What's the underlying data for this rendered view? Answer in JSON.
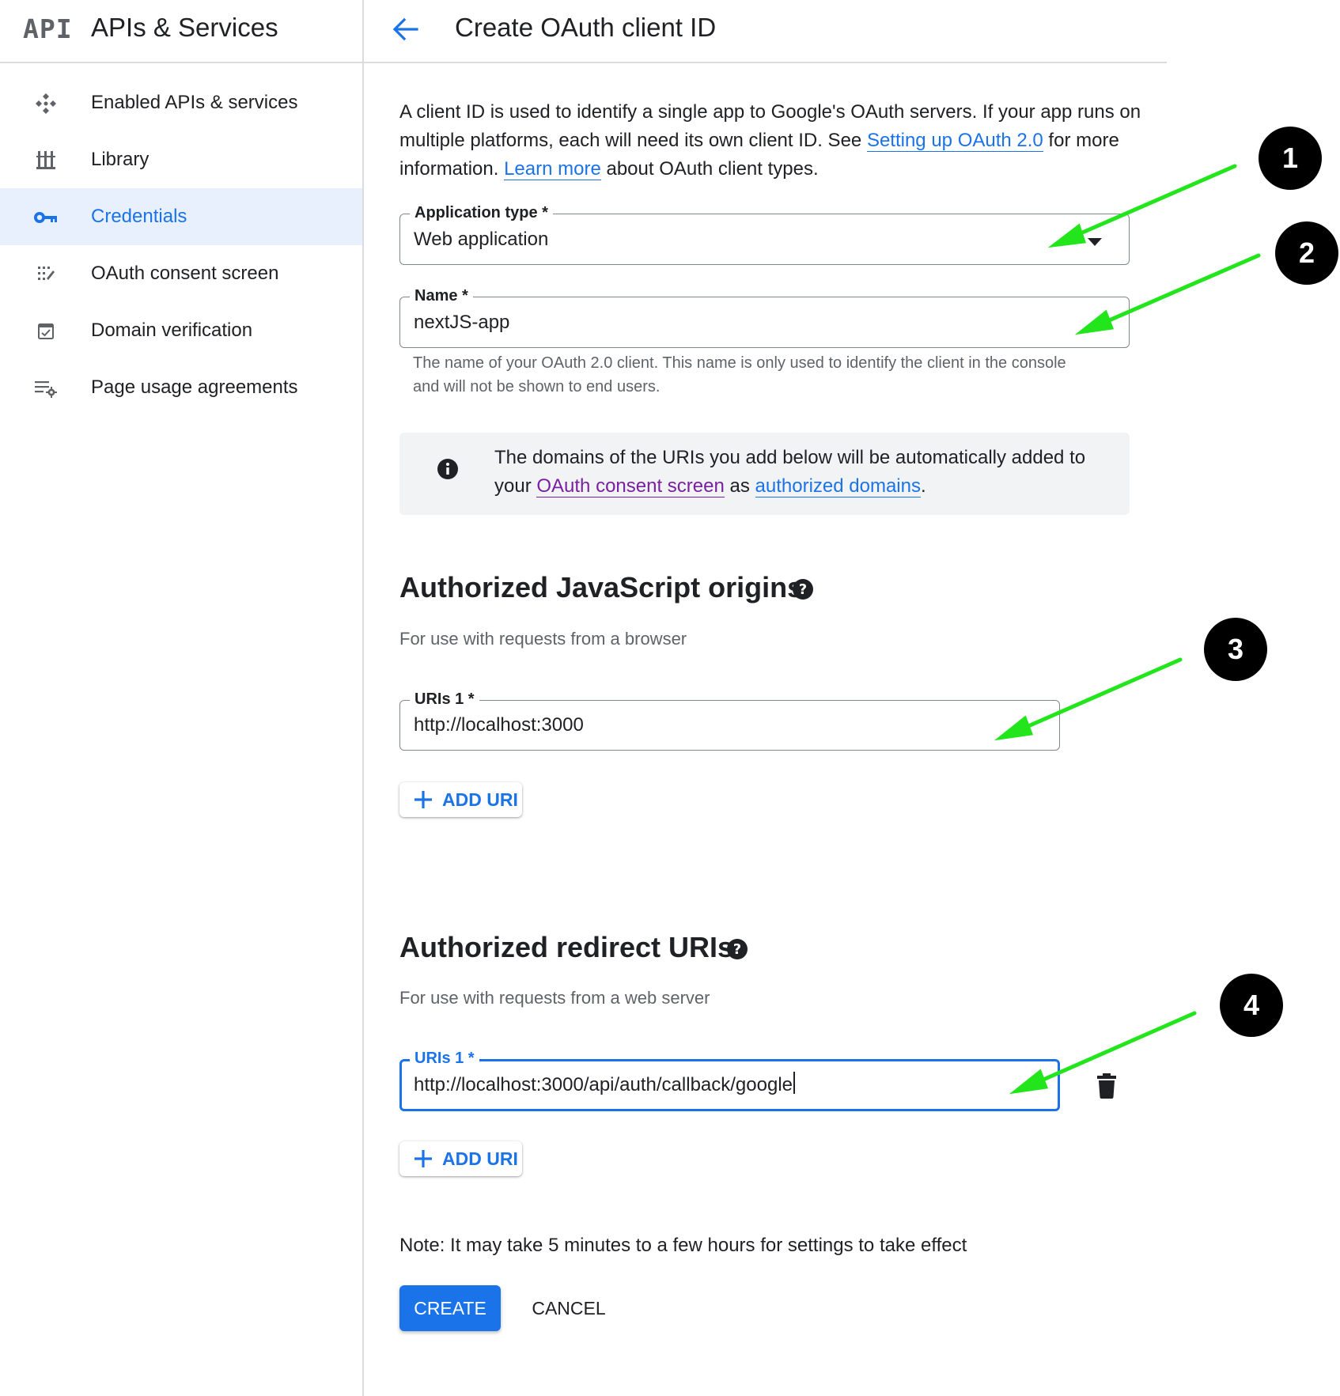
{
  "sidebar": {
    "logo_text": "API",
    "product_title": "APIs & Services",
    "items": [
      {
        "label": "Enabled APIs & services",
        "icon": "enabled-apis-icon"
      },
      {
        "label": "Library",
        "icon": "library-icon"
      },
      {
        "label": "Credentials",
        "icon": "key-icon",
        "active": true
      },
      {
        "label": "OAuth consent screen",
        "icon": "consent-screen-icon"
      },
      {
        "label": "Domain verification",
        "icon": "domain-verification-icon"
      },
      {
        "label": "Page usage agreements",
        "icon": "page-usage-icon"
      }
    ]
  },
  "header": {
    "back_icon": "arrow-back-icon",
    "title": "Create OAuth client ID"
  },
  "intro": {
    "part1": "A client ID is used to identify a single app to Google's OAuth servers. If your app runs on multiple platforms, each will need its own client ID. See ",
    "link1": "Setting up OAuth 2.0",
    "part2": " for more information. ",
    "link2": "Learn more",
    "part3": " about OAuth client types."
  },
  "application_type": {
    "label": "Application type *",
    "value": "Web application"
  },
  "name_field": {
    "label": "Name *",
    "value": "nextJS-app",
    "helper": "The name of your OAuth 2.0 client. This name is only used to identify the client in the console and will not be shown to end users."
  },
  "info_box": {
    "part1": "The domains of the URIs you add below will be automatically added to your ",
    "link1": "OAuth consent screen",
    "part2": " as ",
    "link2": "authorized domains",
    "part3": "."
  },
  "js_origins": {
    "title": "Authorized JavaScript origins",
    "subtitle": "For use with requests from a browser",
    "uri_label": "URIs 1 *",
    "uri_value": "http://localhost:3000",
    "add_label": "ADD URI"
  },
  "redirect_uris": {
    "title": "Authorized redirect URIs",
    "subtitle": "For use with requests from a web server",
    "uri_label": "URIs 1 *",
    "uri_value": "http://localhost:3000/api/auth/callback/google",
    "add_label": "ADD URI"
  },
  "note": "Note: It may take 5 minutes to a few hours for settings to take effect",
  "actions": {
    "create_label": "CREATE",
    "cancel_label": "CANCEL"
  },
  "annotations": {
    "badges": [
      "1",
      "2",
      "3",
      "4"
    ],
    "arrow_color": "#22e51c"
  },
  "colors": {
    "accent": "#1a73e8",
    "active_nav_bg": "#e8f0fe",
    "visited_link": "#7b1fa2"
  }
}
